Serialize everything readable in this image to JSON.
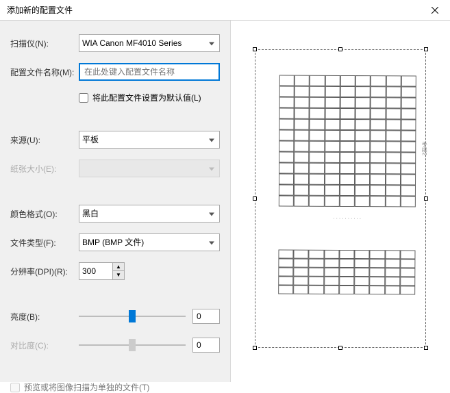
{
  "window": {
    "title": "添加新的配置文件"
  },
  "labels": {
    "scanner": "扫描仪(N):",
    "profileName": "配置文件名称(M):",
    "setDefault": "将此配置文件设置为默认值(L)",
    "source": "来源(U):",
    "paperSize": "纸张大小(E):",
    "colorFormat": "颜色格式(O):",
    "fileType": "文件类型(F):",
    "dpi": "分辨率(DPI)(R):",
    "brightness": "亮度(B):",
    "contrast": "对比度(C):",
    "previewSeparate": "预览或将图像扫描为单独的文件(T)"
  },
  "values": {
    "scanner": "WIA Canon MF4010 Series",
    "profilePlaceholder": "在此处键入配置文件名称",
    "source": "平板",
    "paperSize": "",
    "colorFormat": "黑白",
    "fileType": "BMP (BMP 文件)",
    "dpi": "300",
    "brightness": "0",
    "contrast": "0"
  }
}
